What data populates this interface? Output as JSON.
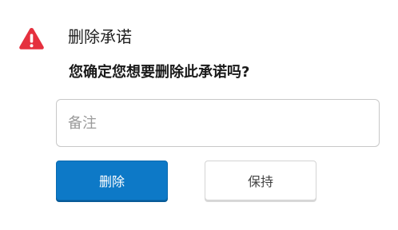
{
  "dialog": {
    "title": "删除承诺",
    "question": "您确定您想要删除此承诺吗?",
    "icon": "warning-triangle-icon",
    "icon_color": "#e5303e"
  },
  "note": {
    "placeholder": "备注",
    "value": ""
  },
  "buttons": {
    "delete_label": "删除",
    "keep_label": "保持",
    "delete_color": "#0d79c7"
  }
}
